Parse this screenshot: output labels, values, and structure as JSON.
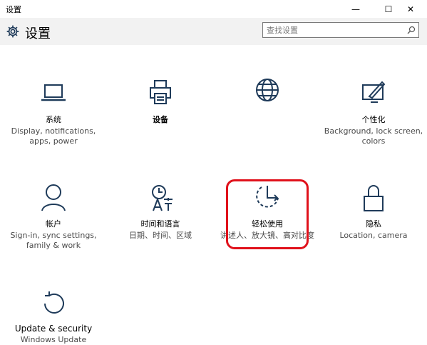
{
  "window": {
    "title": "设置",
    "minimize": "—",
    "maximize": "☐",
    "close": "✕"
  },
  "header": {
    "title": "设置",
    "icon": "gear-icon"
  },
  "search": {
    "placeholder": "查找设置",
    "icon": "search-icon"
  },
  "tiles": [
    {
      "name": "系统",
      "desc": "Display, notifications, apps, power",
      "icon": "laptop-icon"
    },
    {
      "name": "设备",
      "desc": "",
      "icon": "printer-icon"
    },
    {
      "name": "",
      "desc": "",
      "icon": "globe-icon"
    },
    {
      "name": "个性化",
      "desc": "Background, lock screen, colors",
      "icon": "personalization-icon"
    },
    {
      "name": "帐户",
      "desc": "Sign-in, sync settings, family & work",
      "icon": "person-icon"
    },
    {
      "name": "时间和语言",
      "desc": "日期、时间、区域",
      "icon": "time-language-icon"
    },
    {
      "name": "轻松使用",
      "desc": "讲述人、放大镜、高对比度",
      "icon": "ease-of-access-icon",
      "highlighted": true
    },
    {
      "name": "隐私",
      "desc": "Location, camera",
      "icon": "lock-icon"
    },
    {
      "name": "Update & security",
      "desc": "Windows Update",
      "icon": "update-icon"
    }
  ],
  "colors": {
    "accent": "#1f3b5a",
    "highlight_border": "#e0111b",
    "header_bg": "#f2f2f2"
  }
}
